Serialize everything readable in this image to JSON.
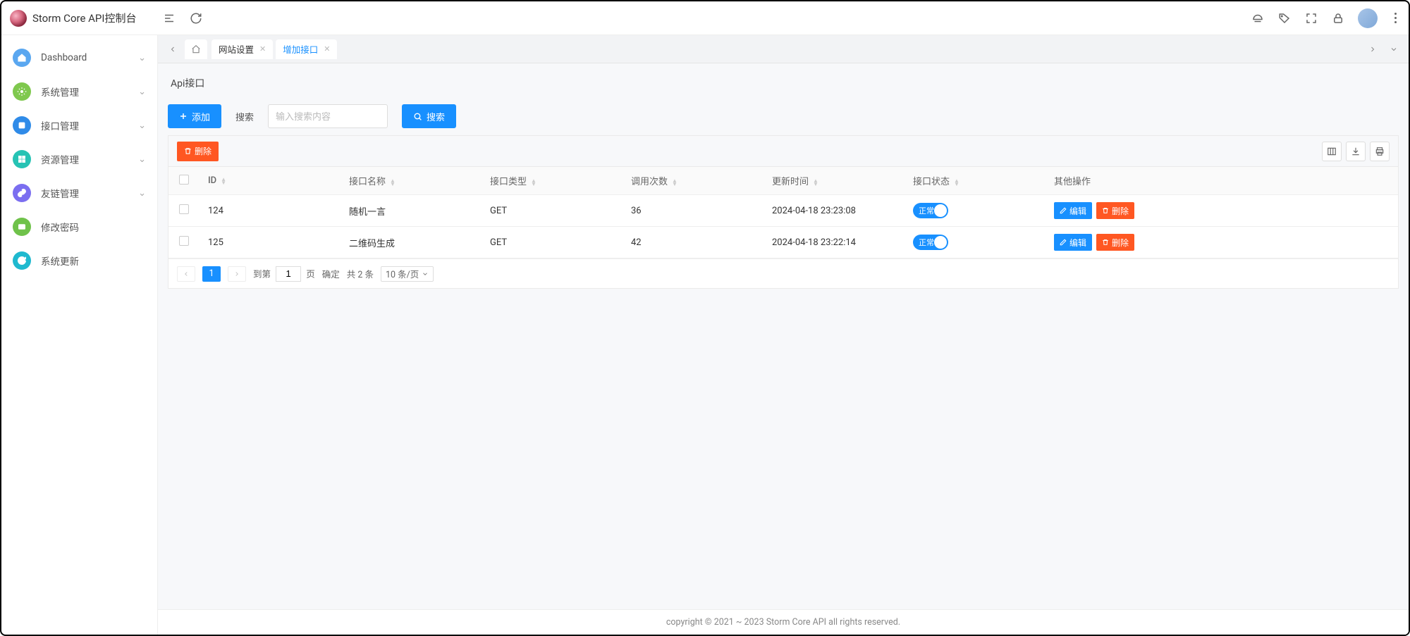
{
  "app": {
    "title": "Storm Core API控制台"
  },
  "sidebar": {
    "items": [
      {
        "label": "Dashboard",
        "expandable": true
      },
      {
        "label": "系统管理",
        "expandable": true
      },
      {
        "label": "接口管理",
        "expandable": true
      },
      {
        "label": "资源管理",
        "expandable": true
      },
      {
        "label": "友链管理",
        "expandable": true
      },
      {
        "label": "修改密码",
        "expandable": false
      },
      {
        "label": "系统更新",
        "expandable": false
      }
    ]
  },
  "tabs": [
    {
      "label": "网站设置",
      "active": false
    },
    {
      "label": "增加接口",
      "active": true
    }
  ],
  "page": {
    "title": "Api接口"
  },
  "toolbar": {
    "add_label": "添加",
    "search_label": "搜索",
    "search_placeholder": "输入搜索内容",
    "search_btn": "搜索",
    "batch_delete": "删除"
  },
  "table": {
    "columns": {
      "id": "ID",
      "name": "接口名称",
      "type": "接口类型",
      "calls": "调用次数",
      "updated": "更新时间",
      "status": "接口状态",
      "ops": "其他操作"
    },
    "status_on": "正常",
    "edit_label": "编辑",
    "delete_label": "删除",
    "rows": [
      {
        "id": "124",
        "name": "随机一言",
        "type": "GET",
        "calls": "36",
        "updated": "2024-04-18 23:23:08"
      },
      {
        "id": "125",
        "name": "二维码生成",
        "type": "GET",
        "calls": "42",
        "updated": "2024-04-18 23:22:14"
      }
    ]
  },
  "pager": {
    "current": "1",
    "jump_prefix": "到第",
    "jump_value": "1",
    "jump_suffix": "页",
    "confirm": "确定",
    "total": "共 2 条",
    "size": "10 条/页"
  },
  "footer": {
    "text": "copyright © 2021 ~ 2023 Storm Core API all rights reserved."
  }
}
